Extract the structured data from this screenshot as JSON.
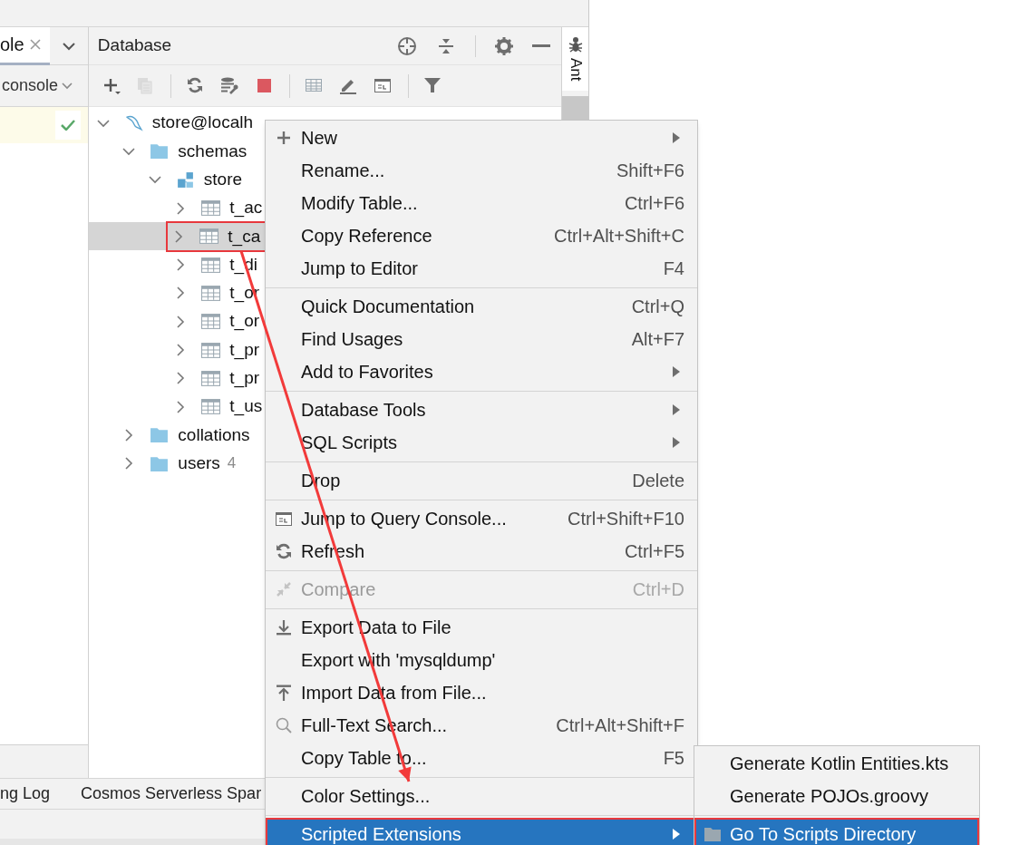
{
  "left_panel": {
    "tab": {
      "label": "ole",
      "selected": true
    },
    "console_dropdown": "console"
  },
  "database_panel": {
    "title": "Database",
    "toolbar": [
      {
        "kind": "add",
        "disabled": false
      },
      {
        "kind": "duplicate",
        "disabled": true
      },
      {
        "kind": "separator"
      },
      {
        "kind": "refresh",
        "disabled": false
      },
      {
        "kind": "db-tools",
        "disabled": false
      },
      {
        "kind": "stop",
        "disabled": false
      },
      {
        "kind": "separator"
      },
      {
        "kind": "table",
        "disabled": false
      },
      {
        "kind": "edit",
        "disabled": false
      },
      {
        "kind": "console",
        "disabled": false
      },
      {
        "kind": "separator"
      },
      {
        "kind": "filter",
        "disabled": false
      }
    ],
    "tree": [
      {
        "label": "store@localh",
        "kind": "datasource",
        "expanded": true,
        "selected": false,
        "children": [
          {
            "label": "schemas",
            "kind": "folder",
            "expanded": true,
            "selected": false,
            "children": [
              {
                "label": "store",
                "kind": "schema",
                "expanded": true,
                "selected": false,
                "children": [
                  {
                    "label": "t_ac",
                    "kind": "table",
                    "expanded": false,
                    "selected": false
                  },
                  {
                    "label": "t_ca",
                    "kind": "table",
                    "expanded": false,
                    "selected": true,
                    "annotated": true
                  },
                  {
                    "label": "t_di",
                    "kind": "table",
                    "expanded": false,
                    "selected": false
                  },
                  {
                    "label": "t_or",
                    "kind": "table",
                    "expanded": false,
                    "selected": false
                  },
                  {
                    "label": "t_or",
                    "kind": "table",
                    "expanded": false,
                    "selected": false
                  },
                  {
                    "label": "t_pr",
                    "kind": "table",
                    "expanded": false,
                    "selected": false
                  },
                  {
                    "label": "t_pr",
                    "kind": "table",
                    "expanded": false,
                    "selected": false
                  },
                  {
                    "label": "t_us",
                    "kind": "table",
                    "expanded": false,
                    "selected": false
                  }
                ]
              }
            ]
          },
          {
            "label": "collations",
            "kind": "folder",
            "expanded": false,
            "selected": false
          },
          {
            "label": "users",
            "count": "4",
            "kind": "folder",
            "expanded": false,
            "selected": false
          }
        ]
      }
    ]
  },
  "side_strip": {
    "label": "Ant"
  },
  "tool_windows": [
    "ng Log",
    "Cosmos Serverless Spar"
  ],
  "context_menu": {
    "items": [
      {
        "kind": "plus",
        "label": "New",
        "submenu": true,
        "disabled": false,
        "selected": false
      },
      {
        "kind": "item",
        "label": "Rename...",
        "shortcut": "Shift+F6",
        "disabled": false,
        "selected": false
      },
      {
        "kind": "item",
        "label": "Modify Table...",
        "shortcut": "Ctrl+F6",
        "disabled": false,
        "selected": false
      },
      {
        "kind": "item",
        "label": "Copy Reference",
        "shortcut": "Ctrl+Alt+Shift+C",
        "disabled": false,
        "selected": false
      },
      {
        "kind": "item",
        "label": "Jump to Editor",
        "shortcut": "F4",
        "disabled": false,
        "selected": false
      },
      {
        "kind": "separator"
      },
      {
        "kind": "item",
        "label": "Quick Documentation",
        "shortcut": "Ctrl+Q",
        "disabled": false,
        "selected": false
      },
      {
        "kind": "item",
        "label": "Find Usages",
        "shortcut": "Alt+F7",
        "disabled": false,
        "selected": false
      },
      {
        "kind": "item",
        "label": "Add to Favorites",
        "submenu": true,
        "disabled": false,
        "selected": false
      },
      {
        "kind": "separator"
      },
      {
        "kind": "item",
        "label": "Database Tools",
        "submenu": true,
        "disabled": false,
        "selected": false
      },
      {
        "kind": "item",
        "label": "SQL Scripts",
        "submenu": true,
        "disabled": false,
        "selected": false
      },
      {
        "kind": "separator"
      },
      {
        "kind": "item",
        "label": "Drop",
        "shortcut": "Delete",
        "disabled": false,
        "selected": false
      },
      {
        "kind": "separator"
      },
      {
        "kind": "console",
        "label": "Jump to Query Console...",
        "shortcut": "Ctrl+Shift+F10",
        "disabled": false,
        "selected": false
      },
      {
        "kind": "refresh",
        "label": "Refresh",
        "shortcut": "Ctrl+F5",
        "disabled": false,
        "selected": false
      },
      {
        "kind": "separator"
      },
      {
        "kind": "compare",
        "label": "Compare",
        "shortcut": "Ctrl+D",
        "disabled": true,
        "selected": false
      },
      {
        "kind": "separator"
      },
      {
        "kind": "download",
        "label": "Export Data to File",
        "disabled": false,
        "selected": false
      },
      {
        "kind": "item",
        "label": "Export with 'mysqldump'",
        "disabled": false,
        "selected": false
      },
      {
        "kind": "upload",
        "label": "Import Data from File...",
        "disabled": false,
        "selected": false
      },
      {
        "kind": "search",
        "label": "Full-Text Search...",
        "shortcut": "Ctrl+Alt+Shift+F",
        "disabled": false,
        "selected": false
      },
      {
        "kind": "item",
        "label": "Copy Table to...",
        "shortcut": "F5",
        "disabled": false,
        "selected": false
      },
      {
        "kind": "separator"
      },
      {
        "kind": "item",
        "label": "Color Settings...",
        "disabled": false,
        "selected": false
      },
      {
        "kind": "separator"
      },
      {
        "kind": "item",
        "label": "Scripted Extensions",
        "submenu": true,
        "disabled": false,
        "selected": true,
        "annotated": true
      }
    ]
  },
  "submenu": {
    "items": [
      {
        "kind": "item",
        "label": "Generate Kotlin Entities.kts",
        "disabled": false,
        "selected": false
      },
      {
        "kind": "item",
        "label": "Generate POJOs.groovy",
        "disabled": false,
        "selected": false
      },
      {
        "kind": "separator"
      },
      {
        "kind": "folder",
        "label": "Go To Scripts Directory",
        "disabled": false,
        "selected": true,
        "annotated": true
      }
    ]
  }
}
